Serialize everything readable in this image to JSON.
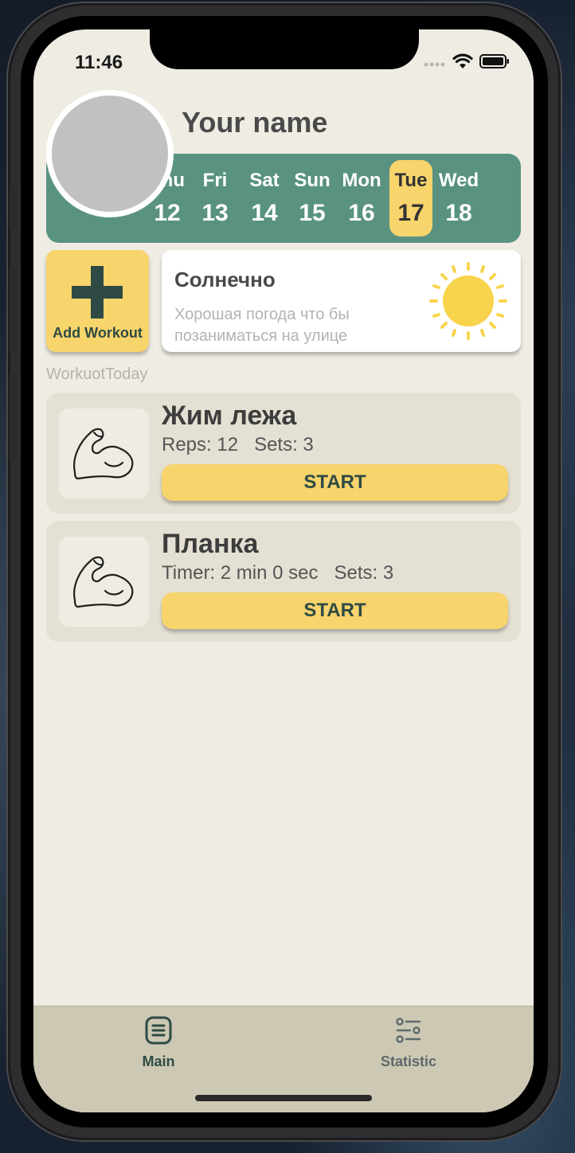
{
  "status_bar": {
    "time": "11:46"
  },
  "profile": {
    "name": "Your name"
  },
  "week": [
    {
      "day": "Thu",
      "date": "12",
      "active": false
    },
    {
      "day": "Fri",
      "date": "13",
      "active": false
    },
    {
      "day": "Sat",
      "date": "14",
      "active": false
    },
    {
      "day": "Sun",
      "date": "15",
      "active": false
    },
    {
      "day": "Mon",
      "date": "16",
      "active": false
    },
    {
      "day": "Tue",
      "date": "17",
      "active": true
    },
    {
      "day": "Wed",
      "date": "18",
      "active": false
    }
  ],
  "add_workout": {
    "label": "Add Workout",
    "icon": "plus-icon"
  },
  "weather": {
    "title": "Солнечно",
    "description": "Хорошая погода что бы позаниматься на улице",
    "icon": "sun-icon"
  },
  "section": {
    "title": "WorkuotToday"
  },
  "workouts": [
    {
      "title": "Жим лежа",
      "info": "Reps: 12   Sets: 3",
      "button": "START",
      "icon": "flexed-biceps-icon"
    },
    {
      "title": "Планка",
      "info": "Timer: 2 min 0 sec   Sets: 3",
      "button": "START",
      "icon": "flexed-biceps-icon"
    }
  ],
  "tabs": [
    {
      "label": "Main",
      "icon": "list-document-icon",
      "active": true
    },
    {
      "label": "Statistic",
      "icon": "sliders-icon",
      "active": false
    }
  ],
  "colors": {
    "background": "#efece3",
    "primary_green": "#5a9282",
    "accent_yellow": "#f7d46c",
    "dark_green": "#2f4a44",
    "card_bg": "#e4e0d3",
    "tabbar_bg": "#ccc8b4",
    "inactive_tab": "#5d6a6a"
  }
}
